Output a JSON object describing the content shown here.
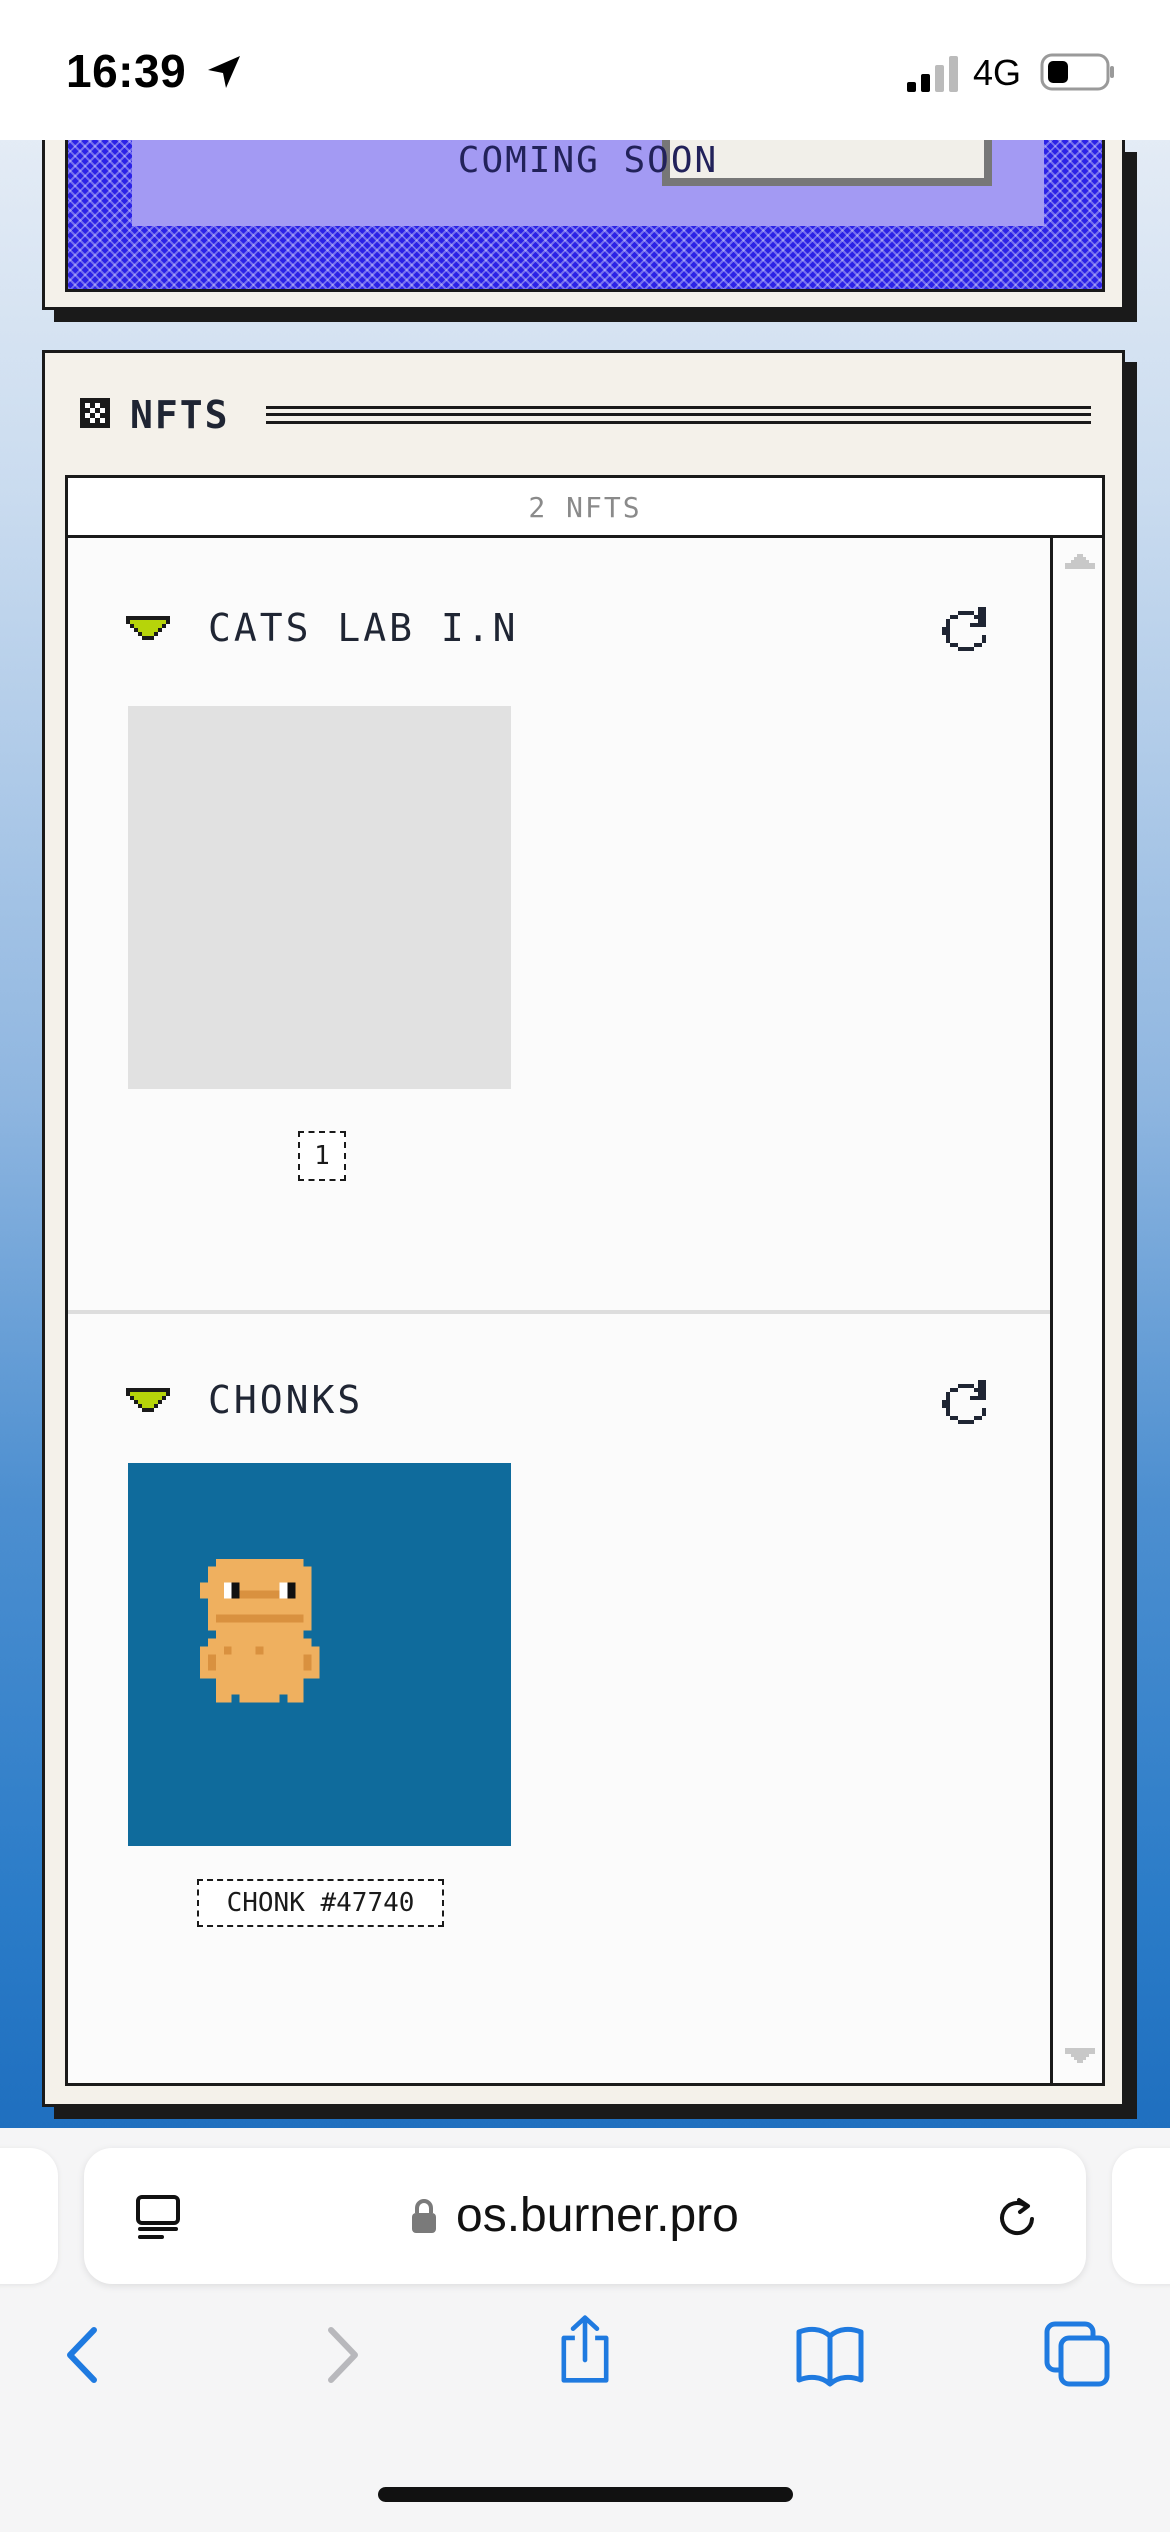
{
  "status_bar": {
    "time": "16:39",
    "network": "4G",
    "icons": [
      "location-arrow-icon",
      "signal-icon",
      "battery-icon"
    ]
  },
  "coming_soon_window": {
    "label": "COMING SOON",
    "accent_color": "#2b22e6"
  },
  "nft_window": {
    "title": "NFTS",
    "title_icon": "checker-icon",
    "count_label": "2 NFTS",
    "collections": [
      {
        "name": "CATS LAB I.N",
        "expand_icon": "chevron-down-icon",
        "refresh_icon": "refresh-icon",
        "items": [
          {
            "tag": "1",
            "image": "placeholder"
          }
        ]
      },
      {
        "name": "CHONKS",
        "expand_icon": "chevron-down-icon",
        "refresh_icon": "refresh-icon",
        "items": [
          {
            "tag": "CHONK #47740",
            "image": "chonk-pixel-character"
          }
        ]
      }
    ],
    "chevron_color": "#b6d40a",
    "chonk_background": "#0f6b9c",
    "chonk_skin": "#efb05f"
  },
  "browser": {
    "url": "os.burner.pro",
    "toolbar": [
      "back-icon",
      "forward-icon",
      "share-icon",
      "bookmarks-icon",
      "tabs-icon"
    ],
    "accent_color": "#1f7ae0"
  }
}
